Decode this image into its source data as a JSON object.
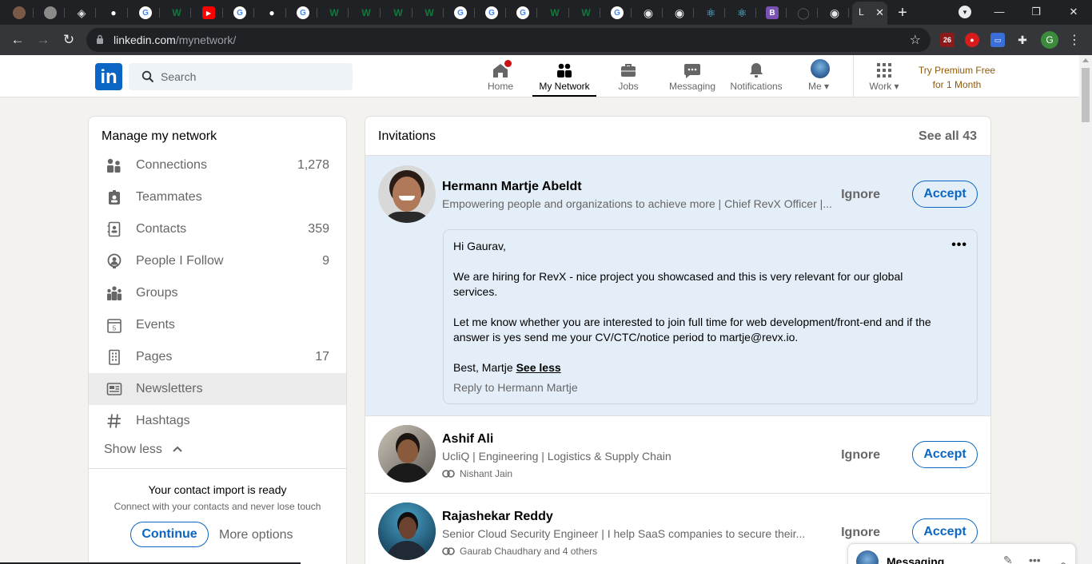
{
  "browser": {
    "tabs": [
      {
        "icon": "avatar-face-icon",
        "color": "#7a5a48"
      },
      {
        "icon": "avatar-face-icon",
        "color": "#8a8a8a"
      },
      {
        "icon": "diamond-logo-icon",
        "color": "#e0e0e0"
      },
      {
        "icon": "figures-icon",
        "color": "#ffffff"
      },
      {
        "icon": "google-icon",
        "color": "#ffffff"
      },
      {
        "icon": "w-logo-icon",
        "color": "#0f7a3b"
      },
      {
        "icon": "youtube-icon",
        "color": "#ff0000"
      },
      {
        "icon": "google-icon",
        "color": "#ffffff"
      },
      {
        "icon": "bird-icon",
        "color": "#ffffff"
      },
      {
        "icon": "google-icon",
        "color": "#ffffff"
      },
      {
        "icon": "w-logo-icon",
        "color": "#0f7a3b"
      },
      {
        "icon": "w-logo-icon",
        "color": "#0f7a3b"
      },
      {
        "icon": "w-logo-icon",
        "color": "#0f7a3b"
      },
      {
        "icon": "w-logo-icon",
        "color": "#0f7a3b"
      },
      {
        "icon": "google-icon",
        "color": "#ffffff"
      },
      {
        "icon": "google-icon",
        "color": "#ffffff"
      },
      {
        "icon": "google-icon",
        "color": "#ffffff"
      },
      {
        "icon": "w-logo-icon",
        "color": "#0f7a3b"
      },
      {
        "icon": "w-logo-icon",
        "color": "#0f7a3b"
      },
      {
        "icon": "google-icon",
        "color": "#ffffff"
      },
      {
        "icon": "globe-icon",
        "color": "#e8eaed"
      },
      {
        "icon": "globe-icon",
        "color": "#e8eaed"
      },
      {
        "icon": "react-icon",
        "color": "#61dafb"
      },
      {
        "icon": "react-icon",
        "color": "#61dafb"
      },
      {
        "icon": "bootstrap-icon",
        "color": "#7952b3"
      },
      {
        "icon": "github-icon",
        "color": "#555555"
      },
      {
        "icon": "globe-icon",
        "color": "#e8eaed"
      }
    ],
    "active_tab_letter": "L",
    "url_host": "linkedin.com",
    "url_path": "/mynetwork/",
    "ext_badge": "26",
    "profile_letter": "G"
  },
  "header": {
    "logo": "in",
    "search_placeholder": "Search",
    "nav": [
      {
        "label": "Home",
        "icon": "home-icon"
      },
      {
        "label": "My Network",
        "icon": "people-icon"
      },
      {
        "label": "Jobs",
        "icon": "briefcase-icon"
      },
      {
        "label": "Messaging",
        "icon": "chat-icon"
      },
      {
        "label": "Notifications",
        "icon": "bell-icon"
      },
      {
        "label": "Me",
        "icon": "avatar-icon"
      },
      {
        "label": "Work",
        "icon": "grid-icon"
      }
    ],
    "premium_line1": "Try Premium Free",
    "premium_line2": "for 1 Month"
  },
  "left": {
    "title": "Manage my network",
    "items": [
      {
        "label": "Connections",
        "count": "1,278",
        "icon": "connections-icon"
      },
      {
        "label": "Teammates",
        "count": "",
        "icon": "badge-icon"
      },
      {
        "label": "Contacts",
        "count": "359",
        "icon": "contacts-icon"
      },
      {
        "label": "People I Follow",
        "count": "9",
        "icon": "follow-icon"
      },
      {
        "label": "Groups",
        "count": "",
        "icon": "groups-icon"
      },
      {
        "label": "Events",
        "count": "",
        "icon": "calendar-icon"
      },
      {
        "label": "Pages",
        "count": "17",
        "icon": "building-icon"
      },
      {
        "label": "Newsletters",
        "count": "",
        "icon": "newspaper-icon"
      },
      {
        "label": "Hashtags",
        "count": "",
        "icon": "hashtag-icon"
      }
    ],
    "show_less": "Show less",
    "import_title": "Your contact import is ready",
    "import_sub": "Connect with your contacts and never lose touch",
    "continue": "Continue",
    "more_options": "More options"
  },
  "invitations": {
    "title": "Invitations",
    "see_all": "See all 43",
    "ignore": "Ignore",
    "accept": "Accept",
    "items": [
      {
        "name": "Hermann Martje Abeldt",
        "headline": "Empowering people and organizations to achieve more | Chief RevX Officer |...",
        "mutual": "",
        "message": {
          "greeting": "Hi Gaurav,",
          "p1": "We are hiring for RevX - nice project you showcased and this is very relevant for our global services.",
          "p2": "Let me know whether you are interested to join full time for web development/front-end and if the answer is yes send me your CV/CTC/notice period to martje@revx.io.",
          "signoff": "Best, Martje",
          "see_less": "See less",
          "reply": "Reply to Hermann Martje",
          "menu": "•••"
        }
      },
      {
        "name": "Ashif Ali",
        "headline": "UcliQ | Engineering | Logistics & Supply Chain",
        "mutual": "Nishant Jain"
      },
      {
        "name": "Rajashekar Reddy",
        "headline": "Senior Cloud Security Engineer | I help SaaS companies to secure their...",
        "mutual": "Gaurab Chaudhary and 4 others"
      }
    ]
  },
  "messaging_dock": {
    "label": "Messaging"
  }
}
